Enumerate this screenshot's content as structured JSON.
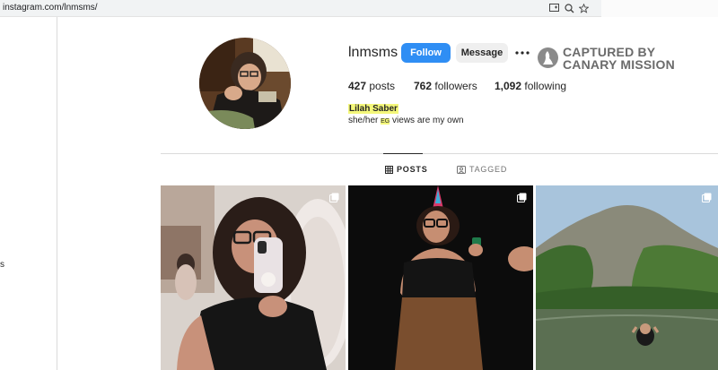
{
  "browser": {
    "url": "instagram.com/lnmsms/",
    "icons": [
      "install-app-icon",
      "zoom-icon",
      "bookmark-star-icon"
    ]
  },
  "left_rail": {
    "clipped_text": "s"
  },
  "profile": {
    "username": "lnmsms",
    "follow_label": "Follow",
    "message_label": "Message",
    "more_label": "•••",
    "stats": {
      "posts_count": "427",
      "posts_label": "posts",
      "followers_count": "762",
      "followers_label": "followers",
      "following_count": "1,092",
      "following_label": "following"
    },
    "full_name": "Lilah Saber",
    "bio_pronouns": "she/her",
    "bio_flag": "EG",
    "bio_text": "views are my own"
  },
  "watermark": {
    "line1": "CAPTURED BY",
    "line2": "CANARY MISSION"
  },
  "tabs": [
    {
      "label": "POSTS",
      "icon": "grid-icon",
      "active": true
    },
    {
      "label": "TAGGED",
      "icon": "tag-person-icon",
      "active": false
    }
  ],
  "posts": [
    {
      "kind": "mirror-selfie",
      "multi": true
    },
    {
      "kind": "party-photo",
      "multi": true
    },
    {
      "kind": "lake-photo",
      "multi": true
    }
  ],
  "colors": {
    "follow_bg": "#2f8ef4",
    "highlight": "#f4f77a",
    "watermark": "#6b6b6b"
  }
}
